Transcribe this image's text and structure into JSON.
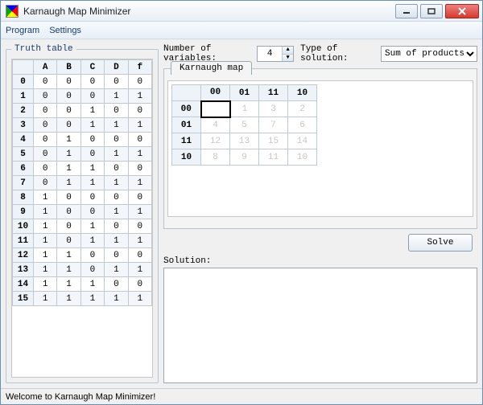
{
  "window": {
    "title": "Karnaugh Map Minimizer"
  },
  "menu": {
    "program": "Program",
    "settings": "Settings"
  },
  "truth": {
    "legend": "Truth table",
    "headers": [
      "A",
      "B",
      "C",
      "D",
      "f"
    ],
    "rows": [
      {
        "i": "0",
        "v": [
          "0",
          "0",
          "0",
          "0",
          "0"
        ]
      },
      {
        "i": "1",
        "v": [
          "0",
          "0",
          "0",
          "1",
          "1"
        ]
      },
      {
        "i": "2",
        "v": [
          "0",
          "0",
          "1",
          "0",
          "0"
        ]
      },
      {
        "i": "3",
        "v": [
          "0",
          "0",
          "1",
          "1",
          "1"
        ]
      },
      {
        "i": "4",
        "v": [
          "0",
          "1",
          "0",
          "0",
          "0"
        ]
      },
      {
        "i": "5",
        "v": [
          "0",
          "1",
          "0",
          "1",
          "1"
        ]
      },
      {
        "i": "6",
        "v": [
          "0",
          "1",
          "1",
          "0",
          "0"
        ]
      },
      {
        "i": "7",
        "v": [
          "0",
          "1",
          "1",
          "1",
          "1"
        ]
      },
      {
        "i": "8",
        "v": [
          "1",
          "0",
          "0",
          "0",
          "0"
        ]
      },
      {
        "i": "9",
        "v": [
          "1",
          "0",
          "0",
          "1",
          "1"
        ]
      },
      {
        "i": "10",
        "v": [
          "1",
          "0",
          "1",
          "0",
          "0"
        ]
      },
      {
        "i": "11",
        "v": [
          "1",
          "0",
          "1",
          "1",
          "1"
        ]
      },
      {
        "i": "12",
        "v": [
          "1",
          "1",
          "0",
          "0",
          "0"
        ]
      },
      {
        "i": "13",
        "v": [
          "1",
          "1",
          "0",
          "1",
          "1"
        ]
      },
      {
        "i": "14",
        "v": [
          "1",
          "1",
          "1",
          "0",
          "0"
        ]
      },
      {
        "i": "15",
        "v": [
          "1",
          "1",
          "1",
          "1",
          "1"
        ]
      }
    ]
  },
  "controls": {
    "numvars_label": "Number of variables:",
    "numvars_value": "4",
    "soltype_label": "Type of solution:",
    "soltype_value": "Sum of products"
  },
  "kmap": {
    "tab": "Karnaugh map",
    "col_headers": [
      "00",
      "01",
      "11",
      "10"
    ],
    "row_headers": [
      "00",
      "01",
      "11",
      "10"
    ],
    "cells": [
      [
        "",
        "1",
        "3",
        "2"
      ],
      [
        "4",
        "5",
        "7",
        "6"
      ],
      [
        "12",
        "13",
        "15",
        "14"
      ],
      [
        "8",
        "9",
        "11",
        "10"
      ]
    ]
  },
  "solve": {
    "button": "Solve",
    "label": "Solution:"
  },
  "status": {
    "text": "Welcome to Karnaugh Map Minimizer!"
  }
}
